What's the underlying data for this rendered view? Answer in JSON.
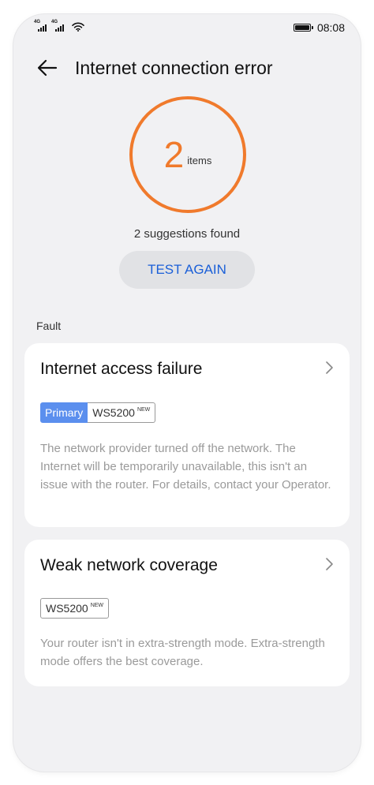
{
  "status_bar": {
    "signal1_tag": "4G",
    "signal2_tag": "4G",
    "time": "08:08",
    "icons": [
      "signal-icon",
      "signal-icon",
      "wifi-icon",
      "battery-icon"
    ]
  },
  "header": {
    "back_icon": "arrow-left-icon",
    "title": "Internet connection error"
  },
  "summary": {
    "count": "2",
    "unit": "items",
    "suggestions": "2 suggestions found",
    "test_again": "TEST AGAIN",
    "ring_color": "#f07a2c"
  },
  "section_label": "Fault",
  "faults": [
    {
      "title": "Internet access failure",
      "tag_primary": "Primary",
      "device": "WS5200",
      "device_badge": "NEW",
      "description": "The network provider turned off the network. The Internet will be temporarily unavailable, this isn't an issue with the router. For details, contact your Operator."
    },
    {
      "title": "Weak network coverage",
      "device": "WS5200",
      "device_badge": "NEW",
      "description": "Your router isn't in extra-strength mode. Extra-strength mode offers the best coverage."
    }
  ],
  "colors": {
    "accent_blue": "#1a5fd8",
    "primary_tag": "#5b8fee",
    "background": "#f1f1f3"
  }
}
